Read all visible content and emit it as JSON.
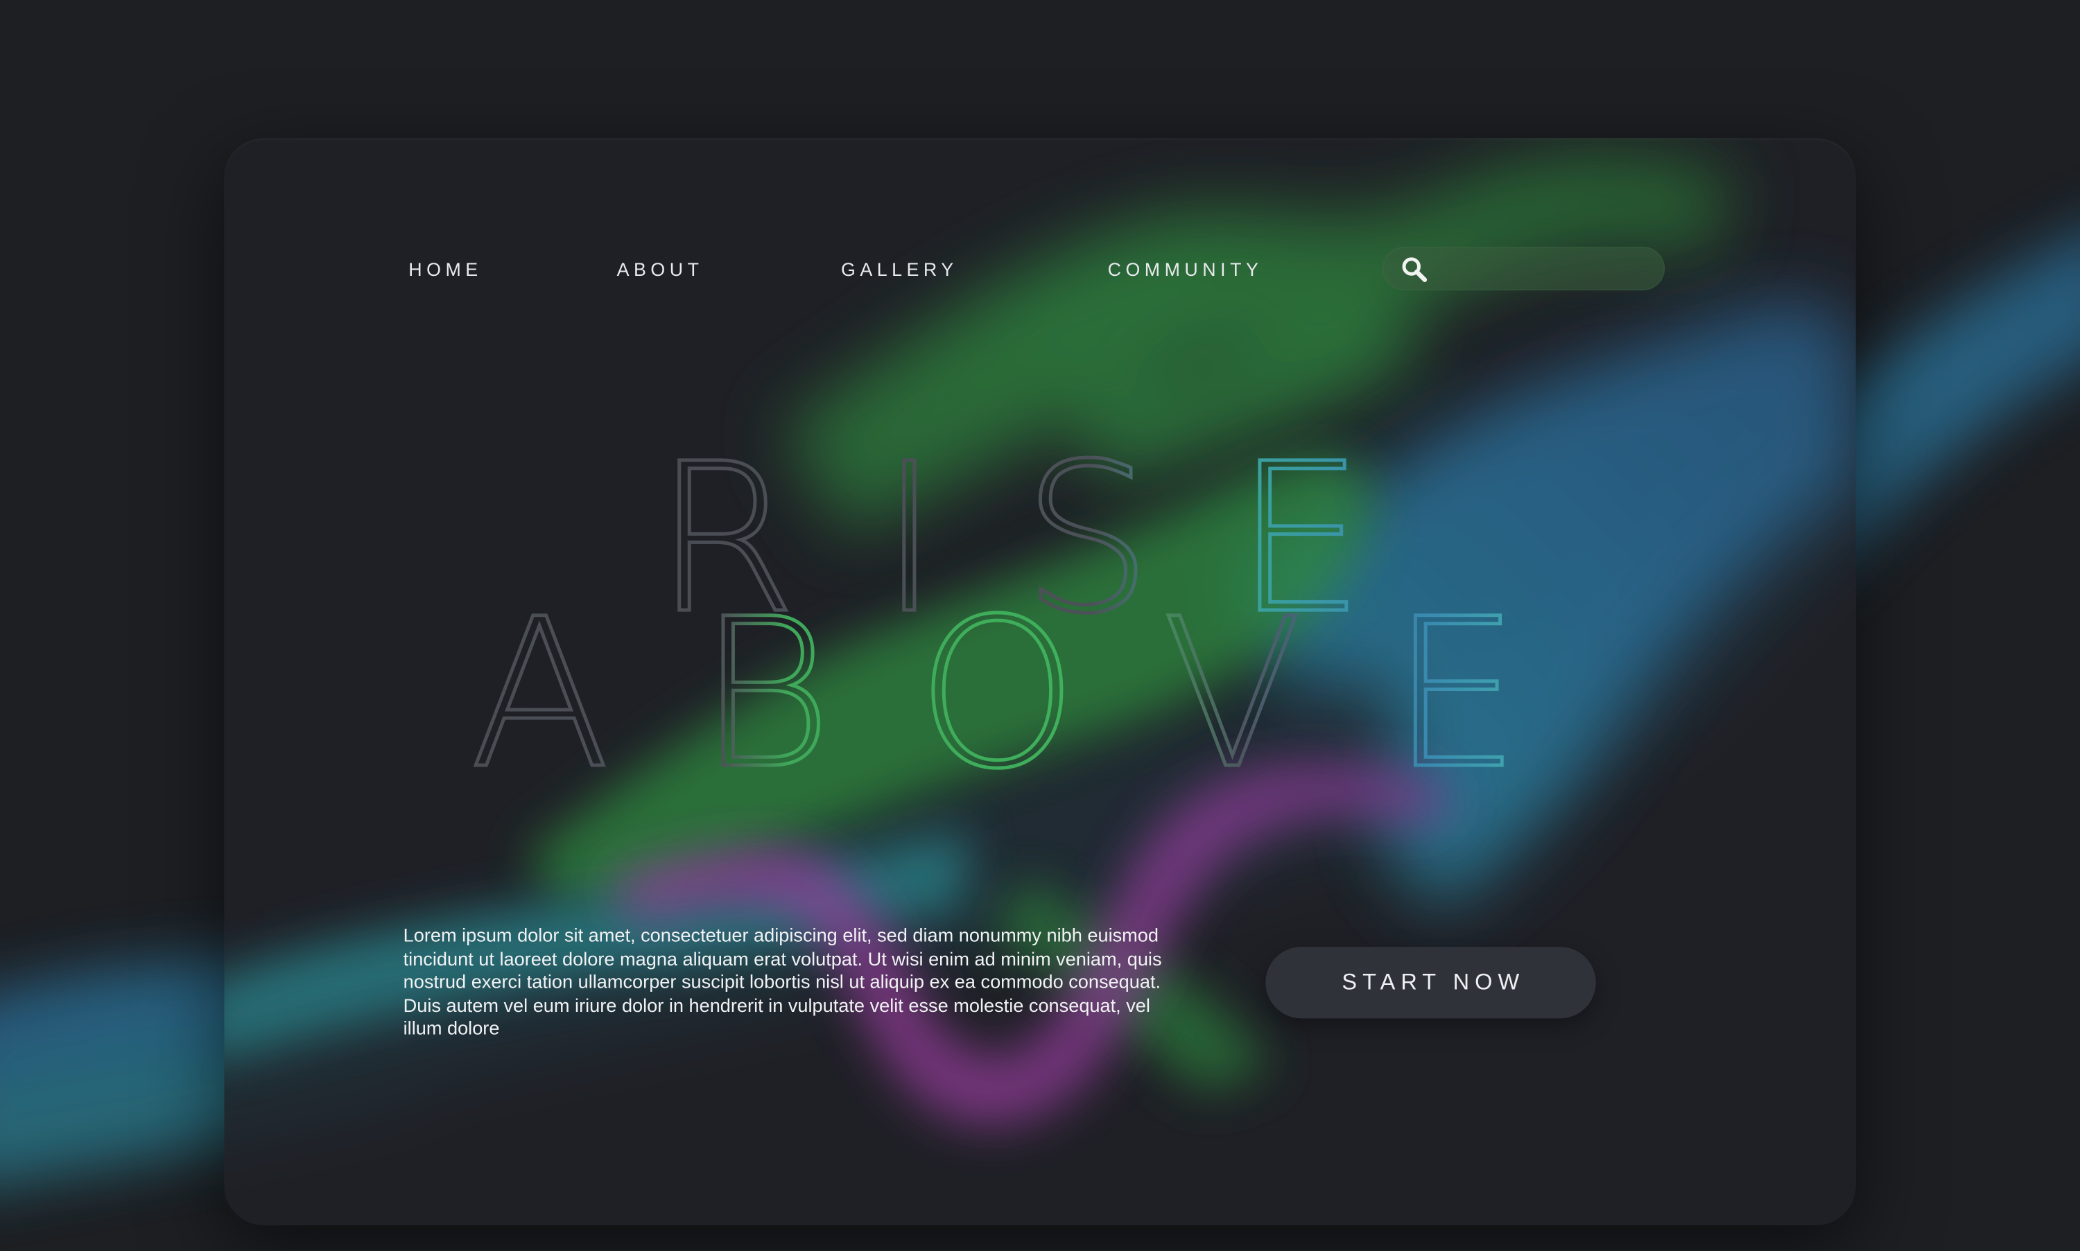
{
  "nav": {
    "items": [
      {
        "label": "HOME"
      },
      {
        "label": "ABOUT"
      },
      {
        "label": "GALLERY"
      },
      {
        "label": "COMMUNITY"
      }
    ]
  },
  "search": {
    "icon": "search-icon",
    "value": "",
    "placeholder": ""
  },
  "hero": {
    "line1": "RISE",
    "line2": "ABOVE"
  },
  "body": {
    "text": "Lorem ipsum dolor sit amet, consectetuer adipiscing elit, sed diam nonummy nibh euismod tincidunt ut laoreet dolore magna aliquam erat volutpat. Ut wisi enim ad minim veniam, quis nostrud exerci tation ullamcorper suscipit lobortis nisl ut aliquip ex ea commodo consequat. Duis autem vel eum iriure dolor in hendrerit in vulputate velit esse molestie consequat, vel illum dolore"
  },
  "cta": {
    "label": "START NOW"
  },
  "colors": {
    "background": "#1d1f23",
    "card": "#1f2126",
    "ribbon_green": "#2f8a3c",
    "ribbon_blue": "#2a6f9a",
    "ribbon_teal": "#2a9a8a",
    "ribbon_purple": "#8a3a8c",
    "text": "#e9eaee",
    "search_bg": "#3a5e3e"
  }
}
